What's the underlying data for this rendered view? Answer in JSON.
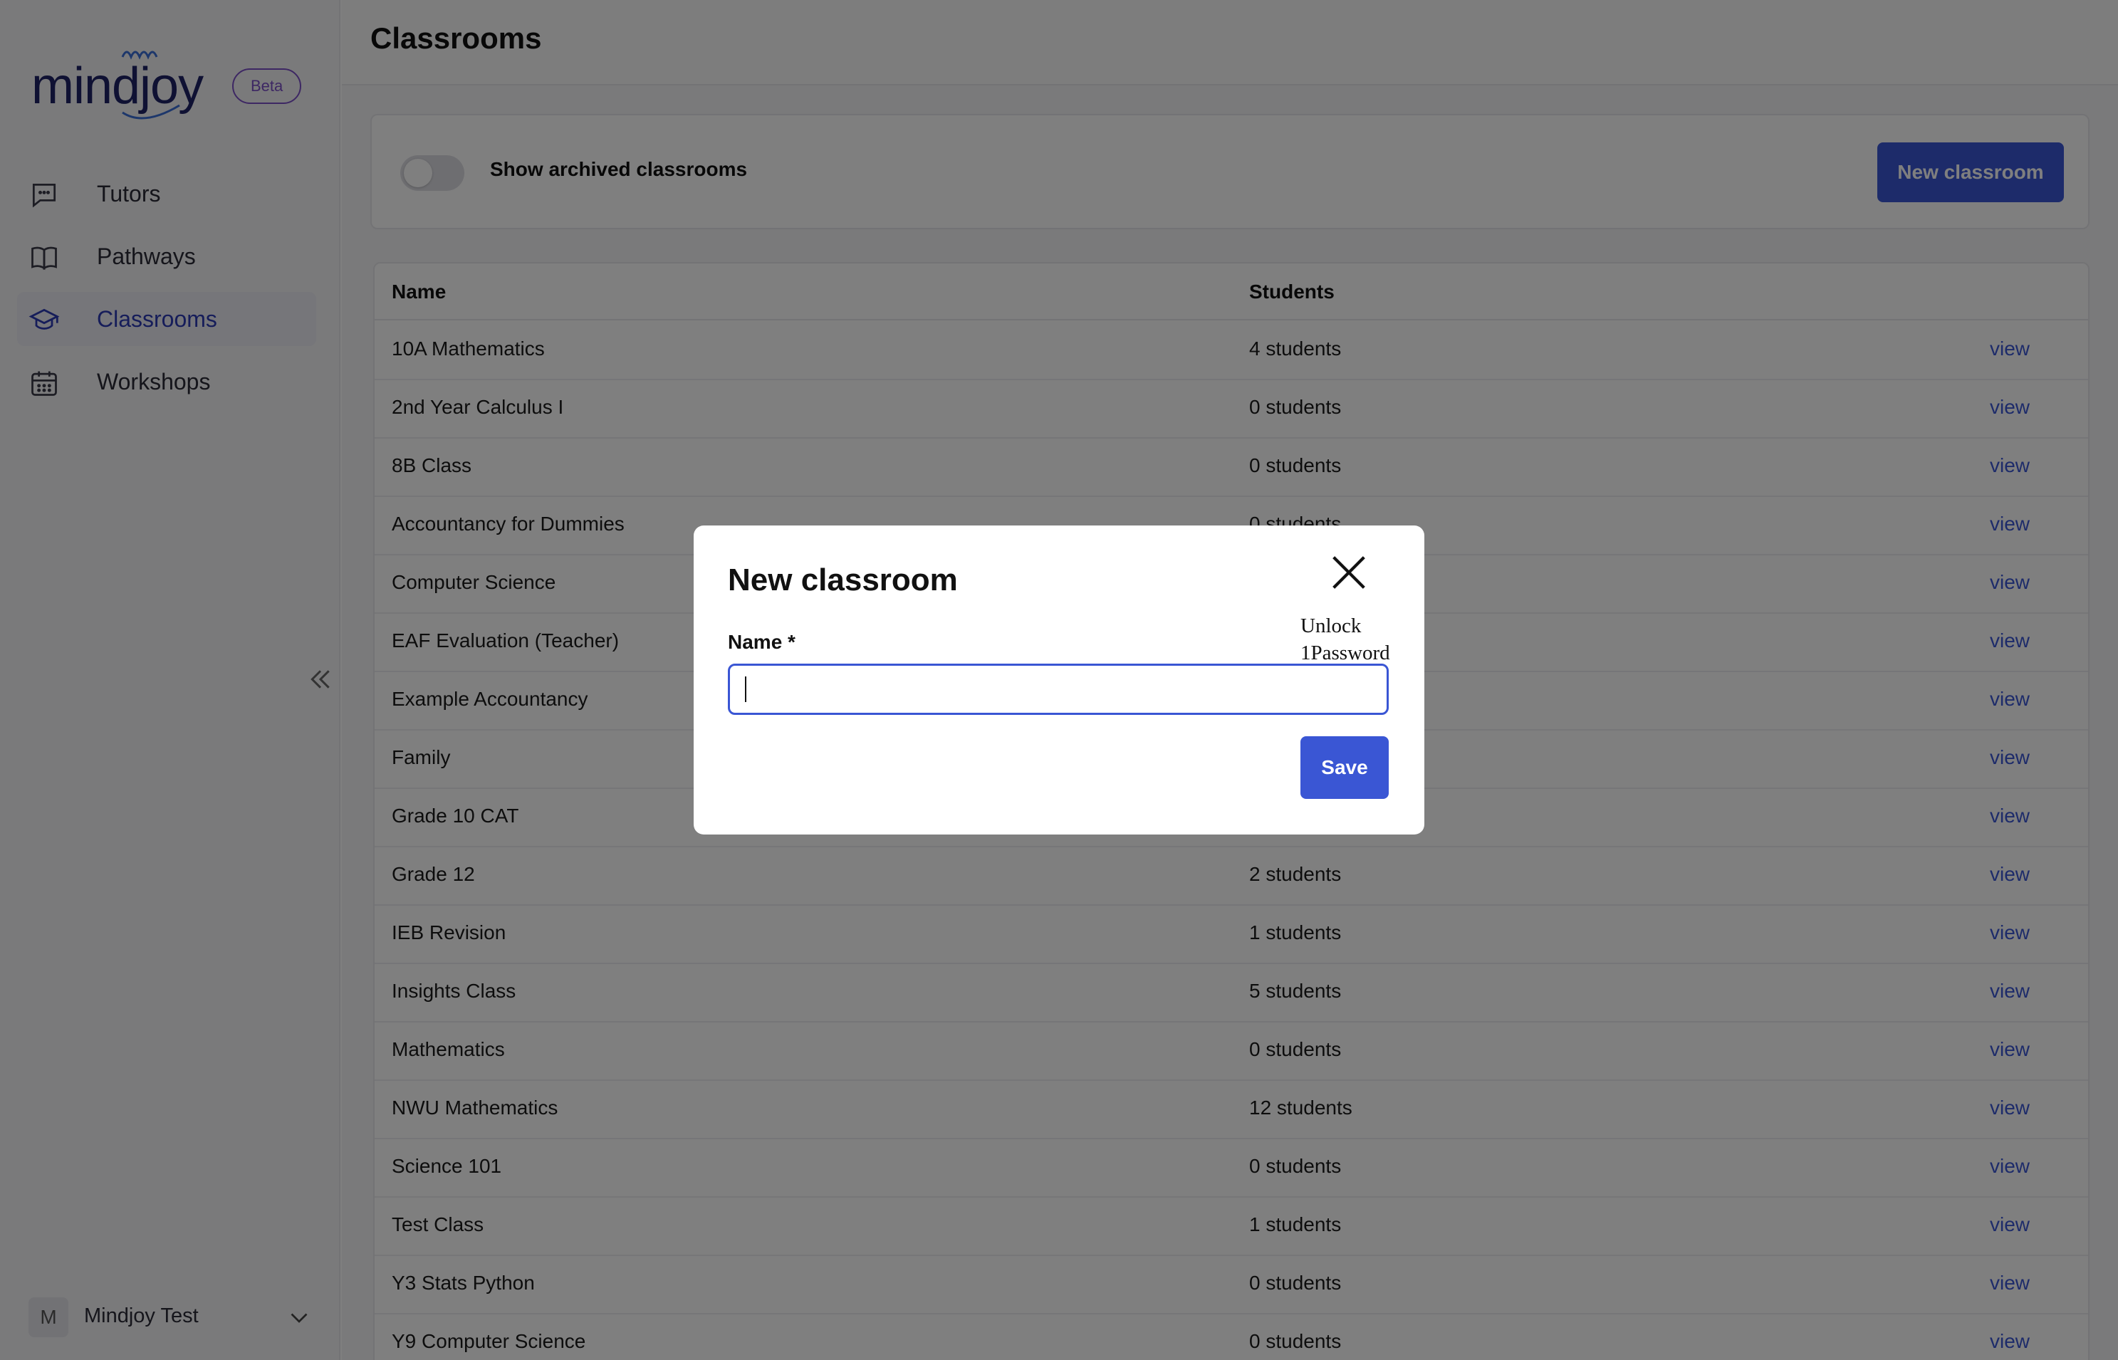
{
  "app": {
    "logo_text": "mindjoy",
    "beta_label": "Beta",
    "page_title": "Classrooms"
  },
  "sidebar": {
    "items": [
      {
        "label": "Tutors",
        "icon": "chat-bubble-icon",
        "active": false
      },
      {
        "label": "Pathways",
        "icon": "open-book-icon",
        "active": false
      },
      {
        "label": "Classrooms",
        "icon": "graduation-cap-icon",
        "active": true
      },
      {
        "label": "Workshops",
        "icon": "calendar-icon",
        "active": false
      }
    ],
    "user": {
      "initial": "M",
      "name": "Mindjoy Test"
    }
  },
  "filters": {
    "toggle_label": "Show archived classrooms",
    "toggle_on": false,
    "new_button_label": "New classroom"
  },
  "table": {
    "columns": [
      "Name",
      "Students"
    ],
    "action_label": "view",
    "rows": [
      {
        "name": "10A Mathematics",
        "students": "4 students"
      },
      {
        "name": "2nd Year Calculus I",
        "students": "0 students"
      },
      {
        "name": "8B Class",
        "students": "0 students"
      },
      {
        "name": "Accountancy for Dummies",
        "students": "0 students"
      },
      {
        "name": "Computer Science",
        "students": ""
      },
      {
        "name": "EAF Evaluation (Teacher)",
        "students": ""
      },
      {
        "name": "Example Accountancy",
        "students": ""
      },
      {
        "name": "Family",
        "students": ""
      },
      {
        "name": "Grade 10 CAT",
        "students": ""
      },
      {
        "name": "Grade 12",
        "students": "2 students"
      },
      {
        "name": "IEB Revision",
        "students": "1 students"
      },
      {
        "name": "Insights Class",
        "students": "5 students"
      },
      {
        "name": "Mathematics",
        "students": "0 students"
      },
      {
        "name": "NWU Mathematics",
        "students": "12 students"
      },
      {
        "name": "Science 101",
        "students": "0 students"
      },
      {
        "name": "Test Class",
        "students": "1 students"
      },
      {
        "name": "Y3 Stats Python",
        "students": "0 students"
      },
      {
        "name": "Y9 Computer Science",
        "students": "0 students"
      }
    ]
  },
  "modal": {
    "title": "New classroom",
    "field_label": "Name *",
    "field_value": "",
    "password_hint_line1": "Unlock",
    "password_hint_line2": "1Password",
    "save_label": "Save"
  },
  "colors": {
    "accent": "#3a56d4",
    "brand": "#1f2366",
    "beta": "#7b4fc7"
  }
}
